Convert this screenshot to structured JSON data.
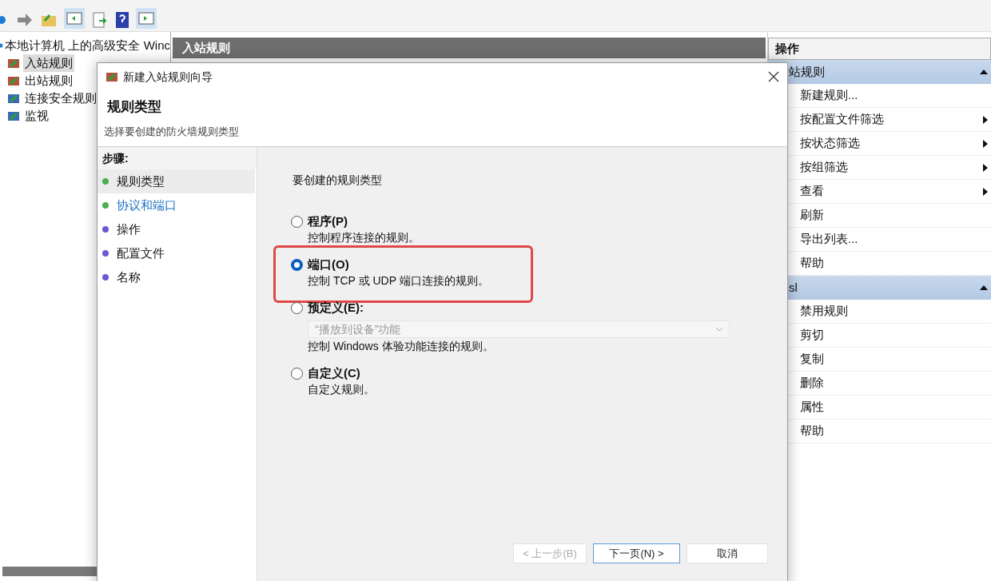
{
  "tree": {
    "root": "本地计算机 上的高级安全 Winc",
    "items": [
      {
        "label": "入站规则",
        "selected": true
      },
      {
        "label": "出站规则",
        "selected": false
      },
      {
        "label": "连接安全规则",
        "selected": false
      },
      {
        "label": "监视",
        "selected": false
      }
    ]
  },
  "center": {
    "title": "入站规则"
  },
  "actions": {
    "title": "操作",
    "sections": [
      {
        "title": "站规则",
        "expanded": true,
        "items": [
          {
            "label": "新建规则...",
            "submenu": false
          },
          {
            "label": "按配置文件筛选",
            "submenu": true
          },
          {
            "label": "按状态筛选",
            "submenu": true
          },
          {
            "label": "按组筛选",
            "submenu": true
          },
          {
            "label": "查看",
            "submenu": true
          },
          {
            "label": "刷新",
            "submenu": false
          },
          {
            "label": "导出列表...",
            "submenu": false
          },
          {
            "label": "帮助",
            "submenu": false
          }
        ]
      },
      {
        "title": "sl",
        "expanded": true,
        "items": [
          {
            "label": "禁用规则",
            "submenu": false
          },
          {
            "label": "剪切",
            "submenu": false
          },
          {
            "label": "复制",
            "submenu": false
          },
          {
            "label": "删除",
            "submenu": false
          },
          {
            "label": "属性",
            "submenu": false
          },
          {
            "label": "帮助",
            "submenu": false
          }
        ]
      }
    ]
  },
  "dialog": {
    "title": "新建入站规则向导",
    "heading": "规则类型",
    "subtitle": "选择要创建的防火墙规则类型",
    "steps_label": "步骤:",
    "steps": [
      {
        "label": "规则类型",
        "selected": true,
        "link": false,
        "color": "#4caf50"
      },
      {
        "label": "协议和端口",
        "selected": false,
        "link": true,
        "color": "#4caf50"
      },
      {
        "label": "操作",
        "selected": false,
        "link": false,
        "color": "#6a5acd"
      },
      {
        "label": "配置文件",
        "selected": false,
        "link": false,
        "color": "#6a5acd"
      },
      {
        "label": "名称",
        "selected": false,
        "link": false,
        "color": "#6a5acd"
      }
    ],
    "prompt": "要创建的规则类型",
    "options": [
      {
        "label": "程序(P)",
        "description": "控制程序连接的规则。",
        "selected": false,
        "highlighted": false
      },
      {
        "label": "端口(O)",
        "description": "控制 TCP 或 UDP 端口连接的规则。",
        "selected": true,
        "highlighted": true
      },
      {
        "label": "预定义(E):",
        "dropdown": {
          "value": "“播放到设备”功能",
          "disabled": true
        },
        "description": "控制 Windows 体验功能连接的规则。",
        "selected": false,
        "highlighted": false
      },
      {
        "label": "自定义(C)",
        "description": "自定义规则。",
        "selected": false,
        "highlighted": false
      }
    ],
    "buttons": [
      {
        "label": "< 上一步(B)",
        "disabled": true,
        "default": false
      },
      {
        "label": "下一页(N) >",
        "disabled": false,
        "default": true
      },
      {
        "label": "取消",
        "disabled": false,
        "default": false
      }
    ]
  }
}
